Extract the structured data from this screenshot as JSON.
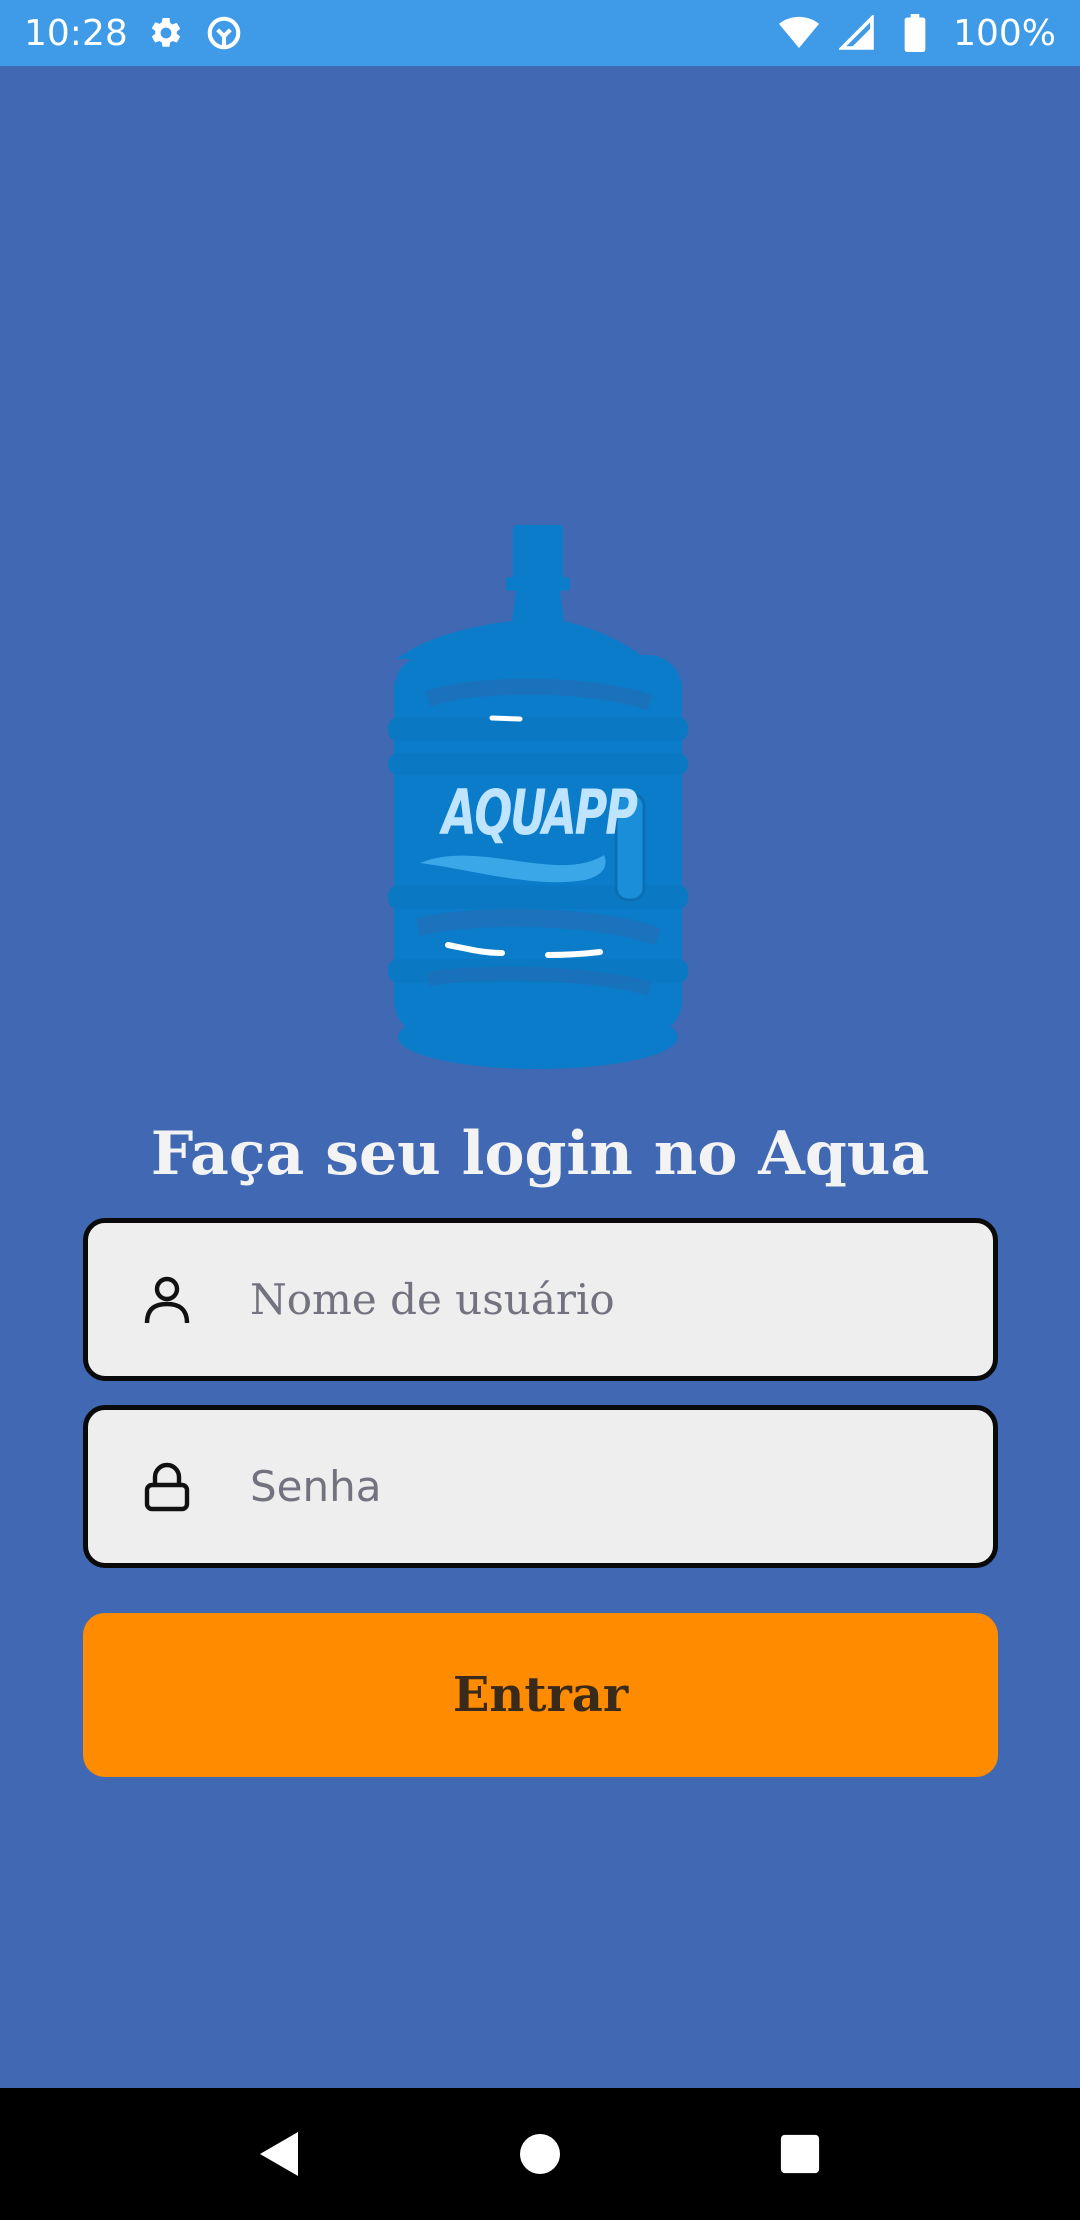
{
  "status_bar": {
    "time": "10:28",
    "battery_percent": "100%",
    "icons": [
      "settings-icon",
      "sync-icon",
      "wifi-icon",
      "signal-icon",
      "battery-icon"
    ]
  },
  "logo": {
    "text": "AQUAPP",
    "icon": "water-jug-icon"
  },
  "login": {
    "title": "Faça seu login no Aqua",
    "username_placeholder": "Nome de usuário",
    "username_value": "",
    "username_icon": "user-icon",
    "password_placeholder": "Senha",
    "password_value": "",
    "password_icon": "lock-icon",
    "submit_label": "Entrar"
  },
  "nav_bar": {
    "icons": [
      "back-icon",
      "home-icon",
      "recents-icon"
    ]
  },
  "colors": {
    "background": "#4169B3",
    "status_bar": "#3F9BE8",
    "button": "#FF8C00",
    "field_bg": "#EEEEEE",
    "jug": "#0A7CC9"
  }
}
